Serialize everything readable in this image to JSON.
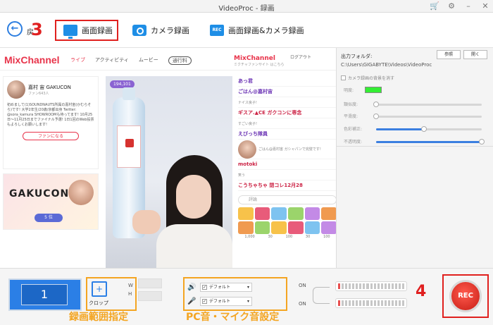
{
  "window": {
    "title": "VideoProc - 録画",
    "icons": [
      "cart-icon",
      "gear-icon",
      "minimize-icon",
      "close-icon"
    ]
  },
  "modebar": {
    "back_label": "戻",
    "annotation_3": "3",
    "modes": [
      {
        "label": "画面録画",
        "icon": "screen-icon"
      },
      {
        "label": "カメラ録画",
        "icon": "camera-icon"
      },
      {
        "label": "画面録画&カメラ録画",
        "icon": "rec-screen-icon",
        "icon_text": "REC"
      }
    ]
  },
  "preview": {
    "logo": "MixChannel",
    "nav": [
      "ライブ",
      "アクティビティ",
      "ムービー",
      "通行料"
    ],
    "logo2": "MixChannel",
    "logo2_sub": "ミクチャファンサイト はこちら",
    "login": "ログアウト",
    "profile": {
      "name": "嘉村 宙 GAKUCON",
      "sub": "ファン643人",
      "bio": "初めまして(1)SOUNDNAUTS所属の嘉村宙(かむらそら)です! 大学2年生/20歳/京都出身 Twitter: @sora_kamura SHOWROOMも待ってます! 10月25日〜11月25日までファイナル予選! 1日1回のWeb投票もよろしくお願いします!",
      "fan_button": "ファンになる"
    },
    "banner": {
      "title": "GAKUCON",
      "badge": "5 位"
    },
    "viewers": "194,101",
    "chat": [
      {
        "text": "あっ君",
        "style": "hl"
      },
      {
        "text": "ごはん@嘉村宙",
        "style": "hl"
      },
      {
        "text": "ナイス良子!",
        "style": "small"
      },
      {
        "text": "ギスア.▲CE ガクコンに専念",
        "style": "red"
      },
      {
        "text": "すごい良子!",
        "style": "small"
      },
      {
        "text": "えびっち隊員",
        "style": "hl"
      },
      {
        "text": "ごはん@嘉村宙 ガシャパンで完璧です!",
        "style": "small"
      },
      {
        "text": "motoki",
        "style": "red"
      },
      {
        "text": "笑う",
        "style": "small"
      },
      {
        "text": "こうちゃちゃ 閉コレ12月28",
        "style": "red"
      }
    ],
    "chat_placeholder": "評論",
    "gift_prices": [
      "1,000",
      "30",
      "100",
      "30",
      "100"
    ]
  },
  "settings": {
    "output_label": "出力フォルダ:",
    "browse_label": "参照",
    "open_label": "開く",
    "path": "C:\\Users\\GIGABYTE\\Videos\\VideoProc",
    "camera_bg_label": "カメラ録画の背景を消す",
    "color_label": "明度:",
    "color": "#33ee33",
    "sliders": [
      {
        "name": "類似度:",
        "value": 0.0
      },
      {
        "name": "平滑度:",
        "value": 0.0
      },
      {
        "name": "色彩補正:",
        "value": 0.45
      },
      {
        "name": "不透明度:",
        "value": 1.0
      }
    ]
  },
  "bottom": {
    "screen_number": "1",
    "crop_label": "クロップ",
    "w_label": "W",
    "h_label": "H",
    "annotation_crop": "録画範囲指定",
    "speaker_device": "デフォルト",
    "mic_device": "デフォルト",
    "annotation_audio": "PC音・マイク音設定",
    "on_label_1": "ON",
    "on_label_2": "ON",
    "meter_1_level": 0.0,
    "meter_2_level": 0.0,
    "annotation_4": "4",
    "rec_label": "REC"
  }
}
